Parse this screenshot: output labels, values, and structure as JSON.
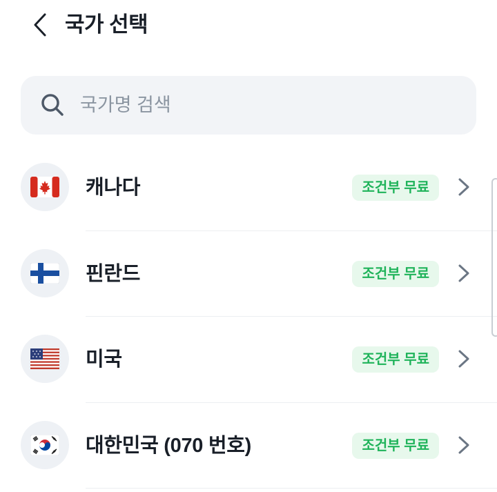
{
  "header": {
    "title": "국가 선택"
  },
  "search": {
    "placeholder": "국가명 검색"
  },
  "countries": [
    {
      "name": "캐나다",
      "badge": "조건부 무료",
      "flag": "canada-flag"
    },
    {
      "name": "핀란드",
      "badge": "조건부 무료",
      "flag": "finland-flag"
    },
    {
      "name": "미국",
      "badge": "조건부 무료",
      "flag": "usa-flag"
    },
    {
      "name": "대한민국 (070 번호)",
      "badge": "조건부 무료",
      "flag": "korea-flag"
    }
  ],
  "colors": {
    "badge_bg": "#e7f8ec",
    "badge_text": "#1fb35a",
    "search_bg": "#f2f4f7",
    "title_text": "#191f28",
    "icon_gray": "#4e5968"
  }
}
